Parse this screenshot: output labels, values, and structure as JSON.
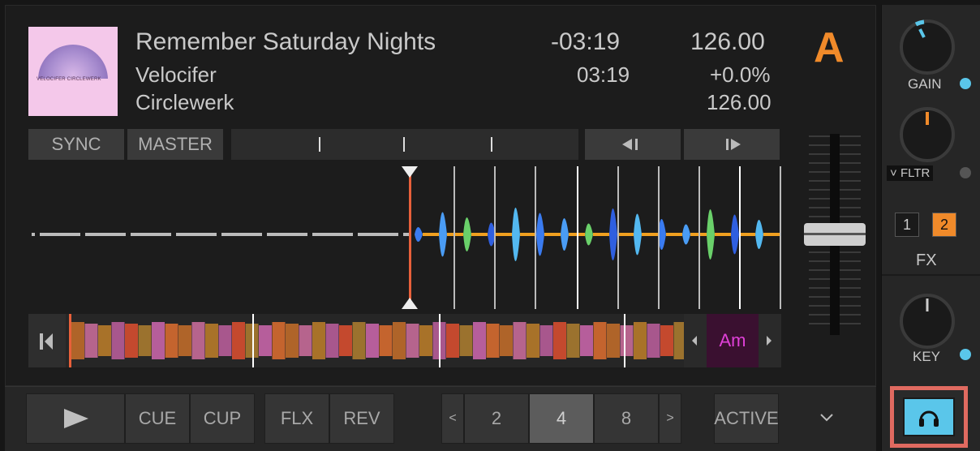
{
  "track": {
    "title": "Remember Saturday Nights",
    "artist": "Velocifer",
    "label": "Circlewerk",
    "time_remaining": "-03:19",
    "time_total": "03:19",
    "bpm": "126.00",
    "tempo_offset": "+0.0%",
    "bpm_original": "126.00",
    "cover_text": "VELOCIFER   CIRCLEWERK"
  },
  "deck": {
    "letter": "A",
    "accent_color": "#f08a2a"
  },
  "sync": {
    "sync_label": "SYNC",
    "master_label": "MASTER"
  },
  "key": {
    "value": "Am",
    "color": "#e040d8"
  },
  "transport": {
    "play_icon": "play-icon",
    "cue_label": "CUE",
    "cup_label": "CUP",
    "flx_label": "FLX",
    "rev_label": "REV",
    "active_label": "ACTIVE",
    "prev": "<",
    "next": ">",
    "loop_sizes": [
      "2",
      "4",
      "8"
    ],
    "loop_selected": "4",
    "collapse_icon": "chevron-down-icon"
  },
  "mixer": {
    "gain_label": "GAIN",
    "filter_label": "FLTR",
    "fx_label": "FX",
    "fx1": "1",
    "fx2": "2",
    "key_label": "KEY",
    "led_color": "#5ac6ea",
    "headphone_color": "#5ac6ea"
  }
}
